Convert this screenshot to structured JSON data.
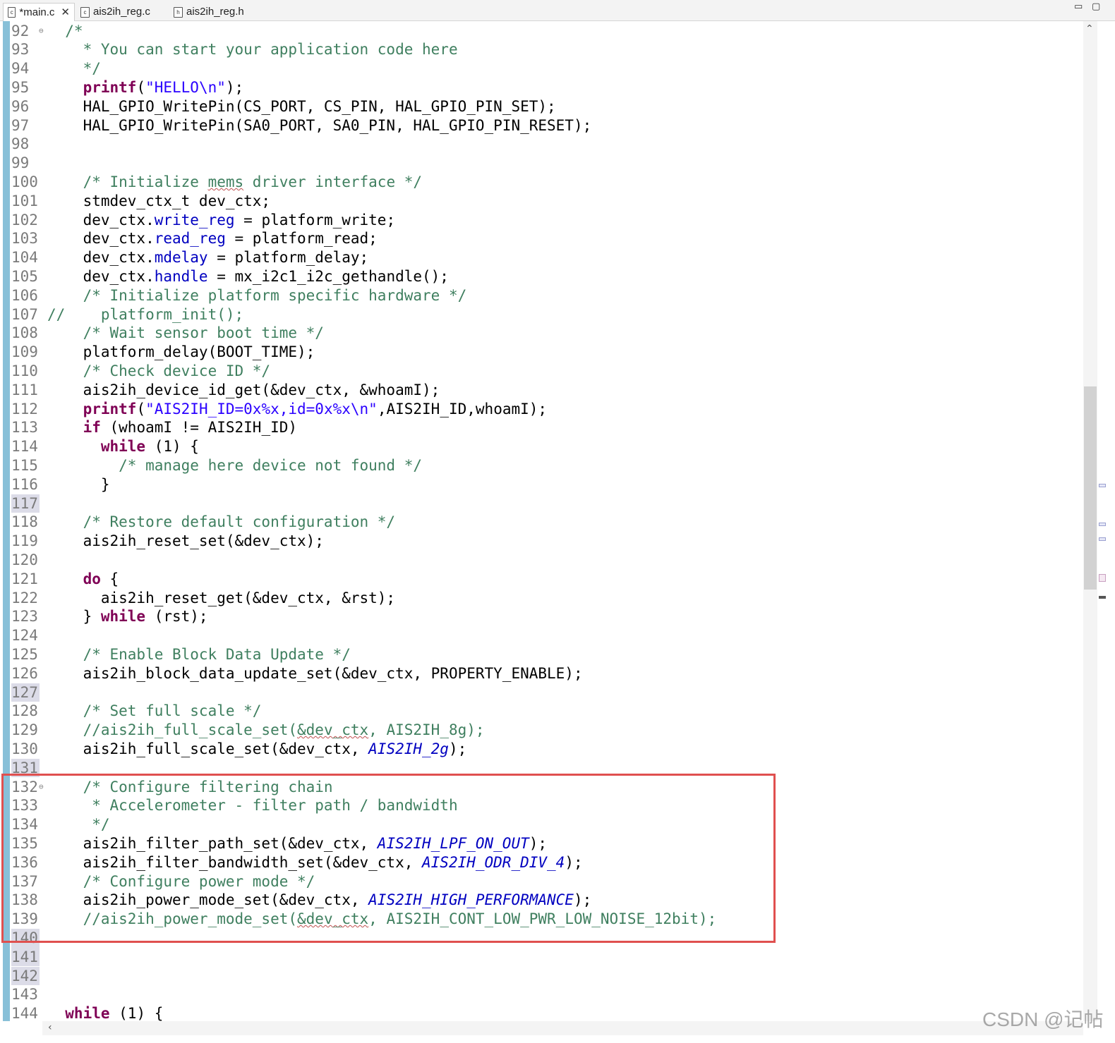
{
  "tabs": [
    {
      "label": "*main.c",
      "icon": "c-file-icon",
      "active": true
    },
    {
      "label": "ais2ih_reg.c",
      "icon": "c-file-icon",
      "active": false
    },
    {
      "label": "ais2ih_reg.h",
      "icon": "h-file-icon",
      "active": false
    }
  ],
  "window_controls": {
    "minimize": "▭",
    "maximize": "▢"
  },
  "editor": {
    "lines": [
      {
        "n": "92",
        "fold": true,
        "segs": [
          [
            "cm",
            "  /*"
          ]
        ]
      },
      {
        "n": "93",
        "segs": [
          [
            "cm",
            "    * You can start your application code here"
          ]
        ]
      },
      {
        "n": "94",
        "segs": [
          [
            "cm",
            "    */"
          ]
        ]
      },
      {
        "n": "95",
        "segs": [
          [
            "p",
            "    "
          ],
          [
            "kw",
            "printf"
          ],
          [
            "p",
            "("
          ],
          [
            "st",
            "\"HELLO\\n\""
          ],
          [
            "p",
            ");"
          ]
        ]
      },
      {
        "n": "96",
        "segs": [
          [
            "p",
            "    HAL_GPIO_WritePin(CS_PORT, CS_PIN, HAL_GPIO_PIN_SET);"
          ]
        ]
      },
      {
        "n": "97",
        "segs": [
          [
            "p",
            "    HAL_GPIO_WritePin(SA0_PORT, SA0_PIN, HAL_GPIO_PIN_RESET);"
          ]
        ]
      },
      {
        "n": "98",
        "segs": []
      },
      {
        "n": "99",
        "segs": []
      },
      {
        "n": "100",
        "segs": [
          [
            "cm",
            "    /* Initialize "
          ],
          [
            "cmsq",
            "mems"
          ],
          [
            "cm",
            " driver interface */"
          ]
        ]
      },
      {
        "n": "101",
        "segs": [
          [
            "p",
            "    stmdev_ctx_t dev_ctx;"
          ]
        ]
      },
      {
        "n": "102",
        "segs": [
          [
            "p",
            "    dev_ctx."
          ],
          [
            "fld",
            "write_reg"
          ],
          [
            "p",
            " = platform_write;"
          ]
        ]
      },
      {
        "n": "103",
        "segs": [
          [
            "p",
            "    dev_ctx."
          ],
          [
            "fld",
            "read_reg"
          ],
          [
            "p",
            " = platform_read;"
          ]
        ]
      },
      {
        "n": "104",
        "segs": [
          [
            "p",
            "    dev_ctx."
          ],
          [
            "fld",
            "mdelay"
          ],
          [
            "p",
            " = platform_delay;"
          ]
        ]
      },
      {
        "n": "105",
        "segs": [
          [
            "p",
            "    dev_ctx."
          ],
          [
            "fld",
            "handle"
          ],
          [
            "p",
            " = mx_i2c1_i2c_gethandle();"
          ]
        ]
      },
      {
        "n": "106",
        "segs": [
          [
            "cm",
            "    /* Initialize platform specific hardware */"
          ]
        ]
      },
      {
        "n": "107",
        "segs": [
          [
            "cm",
            "//    platform_init();"
          ]
        ]
      },
      {
        "n": "108",
        "segs": [
          [
            "cm",
            "    /* Wait sensor boot time */"
          ]
        ]
      },
      {
        "n": "109",
        "segs": [
          [
            "p",
            "    platform_delay(BOOT_TIME);"
          ]
        ]
      },
      {
        "n": "110",
        "segs": [
          [
            "cm",
            "    /* Check device ID */"
          ]
        ]
      },
      {
        "n": "111",
        "segs": [
          [
            "p",
            "    ais2ih_device_id_get(&dev_ctx, &whoamI);"
          ]
        ]
      },
      {
        "n": "112",
        "segs": [
          [
            "p",
            "    "
          ],
          [
            "kw",
            "printf"
          ],
          [
            "p",
            "("
          ],
          [
            "st",
            "\"AIS2IH_ID=0x%x,id=0x%x\\n\""
          ],
          [
            "p",
            ",AIS2IH_ID,whoamI);"
          ]
        ]
      },
      {
        "n": "113",
        "segs": [
          [
            "p",
            "    "
          ],
          [
            "kw",
            "if"
          ],
          [
            "p",
            " (whoamI != AIS2IH_ID)"
          ]
        ]
      },
      {
        "n": "114",
        "segs": [
          [
            "p",
            "      "
          ],
          [
            "kw",
            "while"
          ],
          [
            "p",
            " (1) {"
          ]
        ]
      },
      {
        "n": "115",
        "segs": [
          [
            "cm",
            "        /* manage here device not found */"
          ]
        ]
      },
      {
        "n": "116",
        "segs": [
          [
            "p",
            "      }"
          ]
        ]
      },
      {
        "n": "117",
        "hl": true,
        "segs": []
      },
      {
        "n": "118",
        "segs": [
          [
            "cm",
            "    /* Restore default configuration */"
          ]
        ]
      },
      {
        "n": "119",
        "segs": [
          [
            "p",
            "    ais2ih_reset_set(&dev_ctx);"
          ]
        ]
      },
      {
        "n": "120",
        "segs": []
      },
      {
        "n": "121",
        "segs": [
          [
            "p",
            "    "
          ],
          [
            "kw",
            "do"
          ],
          [
            "p",
            " {"
          ]
        ]
      },
      {
        "n": "122",
        "segs": [
          [
            "p",
            "      ais2ih_reset_get(&dev_ctx, &rst);"
          ]
        ]
      },
      {
        "n": "123",
        "segs": [
          [
            "p",
            "    } "
          ],
          [
            "kw",
            "while"
          ],
          [
            "p",
            " (rst);"
          ]
        ]
      },
      {
        "n": "124",
        "segs": []
      },
      {
        "n": "125",
        "segs": [
          [
            "cm",
            "    /* Enable Block Data Update */"
          ]
        ]
      },
      {
        "n": "126",
        "segs": [
          [
            "p",
            "    ais2ih_block_data_update_set(&dev_ctx, PROPERTY_ENABLE);"
          ]
        ]
      },
      {
        "n": "127",
        "hl": true,
        "segs": []
      },
      {
        "n": "128",
        "segs": [
          [
            "cm",
            "    /* Set full scale */"
          ]
        ]
      },
      {
        "n": "129",
        "segs": [
          [
            "cm",
            "    //ais2ih_full_scale_set("
          ],
          [
            "cmsq",
            "&dev_ctx"
          ],
          [
            "cm",
            ", AIS2IH_8g);"
          ]
        ]
      },
      {
        "n": "130",
        "segs": [
          [
            "p",
            "    ais2ih_full_scale_set(&dev_ctx, "
          ],
          [
            "mac",
            "AIS2IH_2g"
          ],
          [
            "p",
            ");"
          ]
        ]
      },
      {
        "n": "131",
        "hl": true,
        "segs": []
      },
      {
        "n": "132",
        "fold": true,
        "segs": [
          [
            "cm",
            "    /* Configure filtering chain"
          ]
        ]
      },
      {
        "n": "133",
        "segs": [
          [
            "cm",
            "     * Accelerometer - filter path / bandwidth"
          ]
        ]
      },
      {
        "n": "134",
        "segs": [
          [
            "cm",
            "     */"
          ]
        ]
      },
      {
        "n": "135",
        "segs": [
          [
            "p",
            "    ais2ih_filter_path_set(&dev_ctx, "
          ],
          [
            "mac",
            "AIS2IH_LPF_ON_OUT"
          ],
          [
            "p",
            ");"
          ]
        ]
      },
      {
        "n": "136",
        "segs": [
          [
            "p",
            "    ais2ih_filter_bandwidth_set(&dev_ctx, "
          ],
          [
            "mac",
            "AIS2IH_ODR_DIV_4"
          ],
          [
            "p",
            ");"
          ]
        ]
      },
      {
        "n": "137",
        "segs": [
          [
            "cm",
            "    /* Configure power mode */"
          ]
        ]
      },
      {
        "n": "138",
        "segs": [
          [
            "p",
            "    ais2ih_power_mode_set(&dev_ctx, "
          ],
          [
            "mac",
            "AIS2IH_HIGH_PERFORMANCE"
          ],
          [
            "p",
            ");"
          ]
        ]
      },
      {
        "n": "139",
        "segs": [
          [
            "cm",
            "    //ais2ih_power_mode_set("
          ],
          [
            "cmsq",
            "&dev_ctx"
          ],
          [
            "cm",
            ", AIS2IH_CONT_LOW_PWR_LOW_NOISE_12bit);"
          ]
        ]
      },
      {
        "n": "140",
        "hl": true,
        "segs": []
      },
      {
        "n": "141",
        "hl": true,
        "segs": []
      },
      {
        "n": "142",
        "hl": true,
        "segs": []
      },
      {
        "n": "143",
        "segs": []
      },
      {
        "n": "144",
        "segs": [
          [
            "kw",
            "  while"
          ],
          [
            "p",
            " (1) {"
          ]
        ]
      }
    ]
  },
  "watermark": "CSDN @记帖"
}
